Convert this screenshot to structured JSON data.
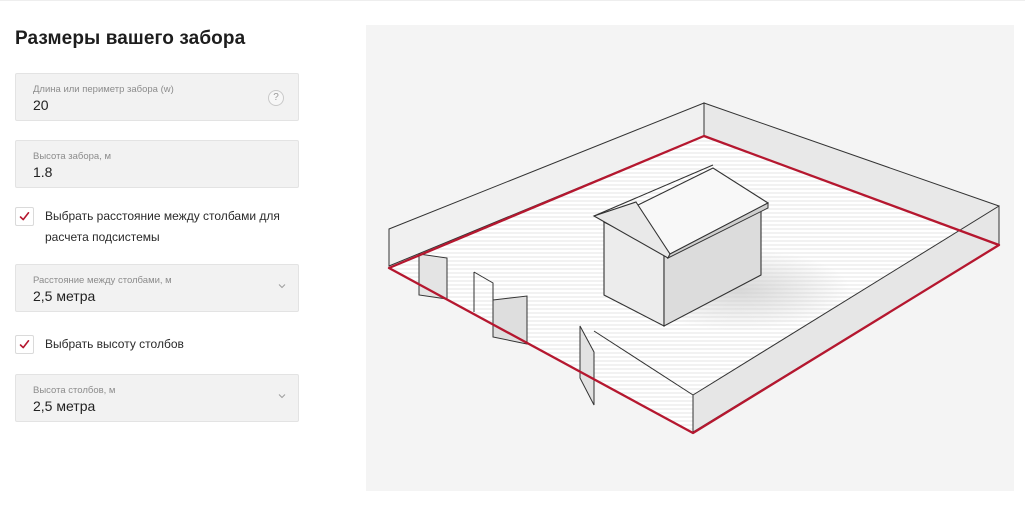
{
  "form": {
    "title": "Размеры вашего забора",
    "length_field": {
      "label": "Длина или периметр забора (w)",
      "value": "20",
      "help_icon": "question-icon",
      "help_text": "?"
    },
    "height_field": {
      "label": "Высота забора, м",
      "value": "1.8"
    },
    "post_spacing_checkbox": {
      "checked": true,
      "label": "Выбрать расстояние между столбами для расчета подсистемы"
    },
    "post_spacing_select": {
      "label": "Расстояние между столбами, м",
      "value": "2,5 метра",
      "icon": "chevron-down-icon"
    },
    "post_height_checkbox": {
      "checked": true,
      "label": "Выбрать высоту столбов"
    },
    "post_height_select": {
      "label": "Высота столбов, м",
      "value": "2,5 метра",
      "icon": "chevron-down-icon"
    }
  },
  "colors": {
    "accent": "#b5172f",
    "panel_bg": "#f4f4f4",
    "field_bg": "#f2f2f2"
  },
  "illustration": {
    "name": "fence-diagram"
  }
}
